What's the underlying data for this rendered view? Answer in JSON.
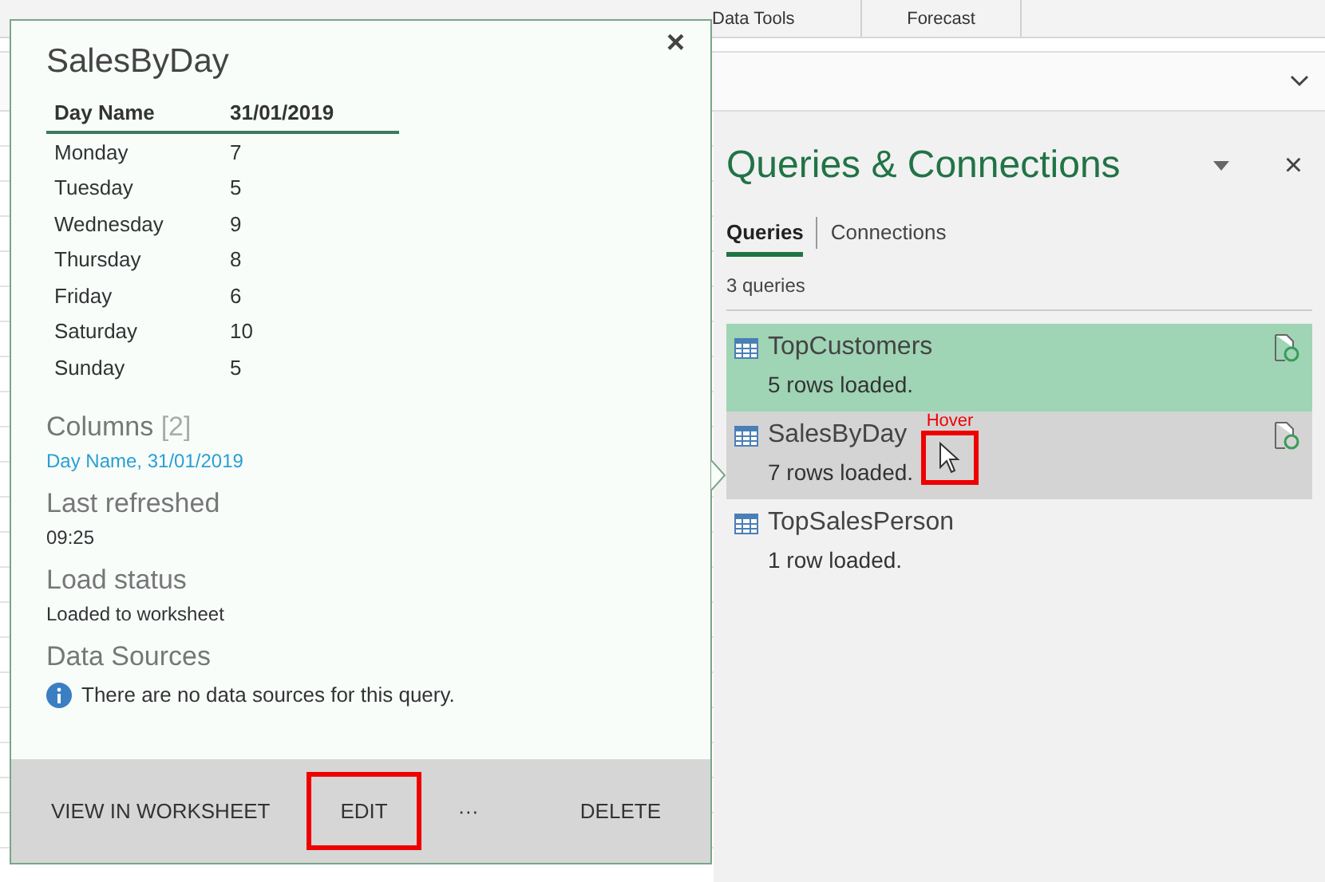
{
  "ribbon": {
    "tabs": [
      "Data Tools",
      "Forecast"
    ]
  },
  "popup": {
    "title": "SalesByDay",
    "close": "×",
    "table": {
      "columns": [
        "Day Name",
        "31/01/2019"
      ],
      "rows": [
        [
          "Monday",
          "7"
        ],
        [
          "Tuesday",
          "5"
        ],
        [
          "Wednesday",
          "9"
        ],
        [
          "Thursday",
          "8"
        ],
        [
          "Friday",
          "6"
        ],
        [
          "Saturday",
          "10"
        ],
        [
          "Sunday",
          "5"
        ]
      ]
    },
    "columns": {
      "label": "Columns",
      "count": "[2]",
      "value": "Day Name, 31/01/2019"
    },
    "last_refreshed": {
      "label": "Last refreshed",
      "value": "09:25"
    },
    "load_status": {
      "label": "Load status",
      "value": "Loaded to worksheet"
    },
    "data_sources": {
      "label": "Data Sources",
      "message": "There are no data sources for this query."
    },
    "actions": [
      {
        "label": "VIEW IN WORKSHEET",
        "highlighted": false
      },
      {
        "label": "EDIT",
        "highlighted": true
      },
      {
        "label": "···",
        "highlighted": false
      },
      {
        "label": "DELETE",
        "highlighted": false
      }
    ]
  },
  "pane": {
    "title": "Queries & Connections",
    "close": "×",
    "tabs": [
      {
        "label": "Queries",
        "selected": true
      },
      {
        "label": "Connections",
        "selected": false
      }
    ],
    "count": "3 queries",
    "queries": [
      {
        "name": "TopCustomers",
        "status": "5 rows loaded.",
        "selected": true,
        "hovered": false
      },
      {
        "name": "SalesByDay",
        "status": "7 rows loaded.",
        "selected": false,
        "hovered": true
      },
      {
        "name": "TopSalesPerson",
        "status": "1 row loaded.",
        "selected": false,
        "hovered": false
      }
    ],
    "hover_annotation": "Hover"
  }
}
